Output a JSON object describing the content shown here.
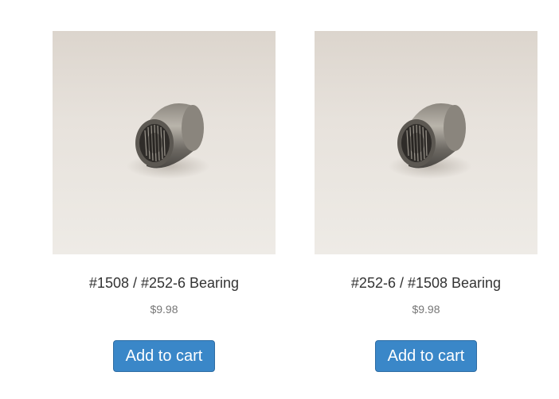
{
  "products": [
    {
      "title": "#1508 / #252-6 Bearing",
      "price": "$9.98",
      "button_label": "Add to cart",
      "image_alt": "needle-bearing-photo"
    },
    {
      "title": "#252-6 / #1508 Bearing",
      "price": "$9.98",
      "button_label": "Add to cart",
      "image_alt": "needle-bearing-photo"
    }
  ],
  "colors": {
    "button_bg": "#3a87c8",
    "button_border": "#2e6da4",
    "title_text": "#333333",
    "price_text": "#777777"
  }
}
